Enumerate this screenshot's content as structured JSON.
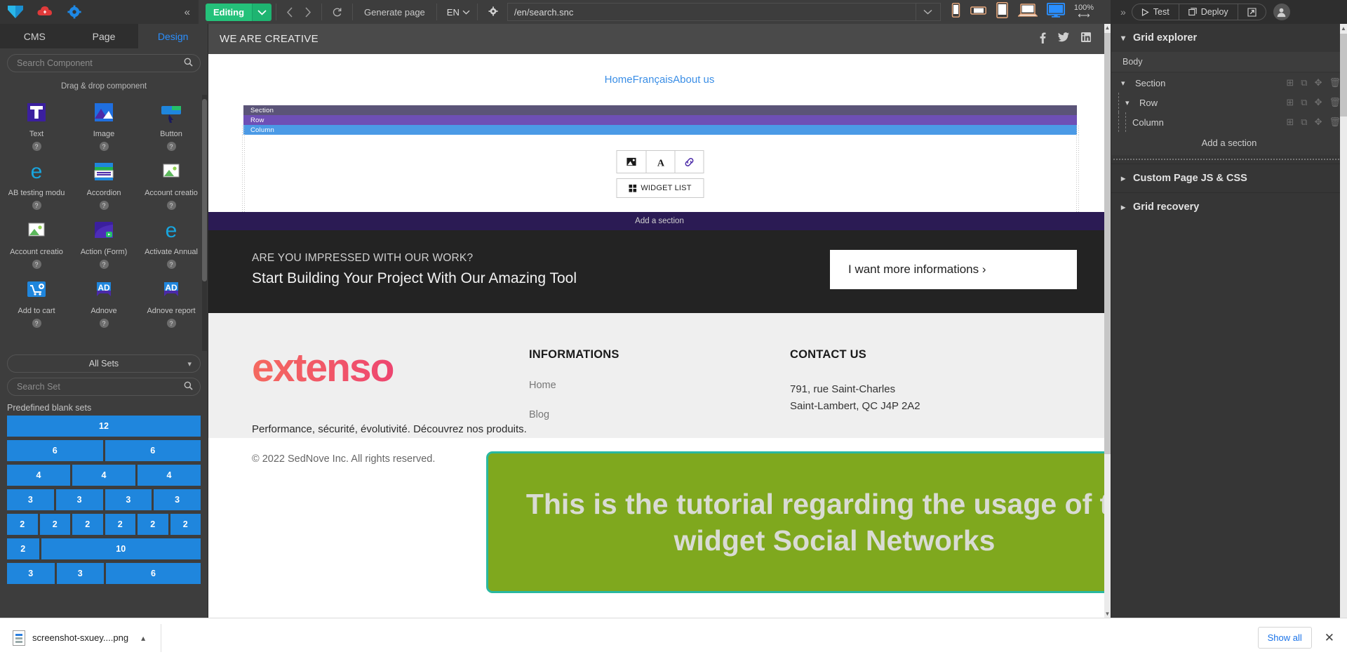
{
  "topbar": {
    "collapse_icon": "chevrons-left-icon",
    "editing_label": "Editing",
    "back_icon": "chevron-left-icon",
    "forward_icon": "chevron-right-icon",
    "refresh_icon": "refresh-icon",
    "generate_page_label": "Generate page",
    "language": "EN",
    "settings_icon": "gear-icon",
    "url_value": "/en/search.snc",
    "url_placeholder": "/en/search.snc",
    "zoom_level": "100%",
    "devices": [
      "mobile-portrait-icon",
      "mobile-landscape-icon",
      "tablet-icon",
      "laptop-icon",
      "desktop-icon"
    ],
    "expand_icon": "chevrons-right-icon",
    "test_label": "Test",
    "deploy_label": "Deploy",
    "open_external_icon": "external-link-icon",
    "avatar_icon": "user-avatar-icon"
  },
  "left_panel": {
    "tabs": [
      {
        "label": "CMS",
        "active": false
      },
      {
        "label": "Page",
        "active": false
      },
      {
        "label": "Design",
        "active": true
      }
    ],
    "search_component_placeholder": "Search Component",
    "drag_drop_title": "Drag & drop component",
    "components": [
      {
        "label": "Text",
        "icon": "text-widget-icon"
      },
      {
        "label": "Image",
        "icon": "image-widget-icon"
      },
      {
        "label": "Button",
        "icon": "button-widget-icon"
      },
      {
        "label": "AB testing modu",
        "icon": "ab-testing-icon"
      },
      {
        "label": "Accordion",
        "icon": "accordion-icon"
      },
      {
        "label": "Account creatio",
        "icon": "account-creation-icon"
      },
      {
        "label": "Account creatio",
        "icon": "account-creation-icon"
      },
      {
        "label": "Action (Form)",
        "icon": "action-form-icon"
      },
      {
        "label": "Activate Annual",
        "icon": "activate-annual-icon"
      },
      {
        "label": "Add to cart",
        "icon": "add-to-cart-icon"
      },
      {
        "label": "Adnove",
        "icon": "adnove-icon"
      },
      {
        "label": "Adnove report",
        "icon": "adnove-report-icon"
      }
    ],
    "all_sets_label": "All Sets",
    "search_set_placeholder": "Search Set",
    "predefined_title": "Predefined blank sets",
    "blank_sets": [
      [
        "12"
      ],
      [
        "6",
        "6"
      ],
      [
        "4",
        "4",
        "4"
      ],
      [
        "3",
        "3",
        "3",
        "3"
      ],
      [
        "2",
        "2",
        "2",
        "2",
        "2",
        "2"
      ],
      [
        "2",
        "10"
      ],
      [
        "3",
        "3",
        "6"
      ]
    ]
  },
  "canvas": {
    "site_brand": "WE ARE CREATIVE",
    "socials": [
      "facebook-icon",
      "twitter-icon",
      "linkedin-icon"
    ],
    "nav_links": [
      "Home",
      "Français",
      "About us"
    ],
    "grid_labels": {
      "section": "Section",
      "row": "Row",
      "column": "Column"
    },
    "widget_tools": [
      "image-icon",
      "text-icon",
      "link-icon"
    ],
    "widget_list_label": "WIDGET LIST",
    "add_section_label": "Add a section",
    "cta": {
      "eyebrow": "ARE YOU IMPRESSED WITH OUR WORK?",
      "headline": "Start Building Your Project With Our Amazing Tool",
      "button": "I want more informations ›"
    },
    "footer": {
      "logo_text": "extenso",
      "paragraph": "Performance, sécurité, évolutivité. Découvrez nos produits.",
      "informations_title": "INFORMATIONS",
      "informations_links": [
        "Home",
        "Blog"
      ],
      "contact_title": "CONTACT US",
      "address_line1": "791, rue Saint-Charles",
      "address_line2": "Saint-Lambert, QC J4P 2A2",
      "copyright": "© 2022 SedNove Inc. All rights reserved."
    },
    "tutorial_overlay": "This is the tutorial regarding the usage of the widget Social Networks"
  },
  "right_panel": {
    "grid_explorer_title": "Grid explorer",
    "body_label": "Body",
    "tree": [
      {
        "label": "Section",
        "depth": 0,
        "expandable": true
      },
      {
        "label": "Row",
        "depth": 1,
        "expandable": true
      },
      {
        "label": "Column",
        "depth": 2,
        "expandable": false
      }
    ],
    "row_actions": [
      "add-icon",
      "duplicate-icon",
      "move-icon",
      "delete-icon"
    ],
    "add_section_label": "Add a section",
    "custom_js_css_title": "Custom Page JS & CSS",
    "grid_recovery_title": "Grid recovery"
  },
  "download_bar": {
    "file_name": "screenshot-sxuey....png",
    "caret_icon": "chevron-up-icon",
    "show_all_label": "Show all",
    "close_icon": "close-icon"
  },
  "colors": {
    "accent_blue": "#2a8fff",
    "editing_green": "#24c17a",
    "set_blue": "#1f86dd",
    "section_bar": "#5b5478",
    "row_bar": "#6e4fb6",
    "column_bar": "#4b9ae6",
    "tutorial_green": "#7fa81e",
    "tutorial_border": "#29b8a0"
  }
}
